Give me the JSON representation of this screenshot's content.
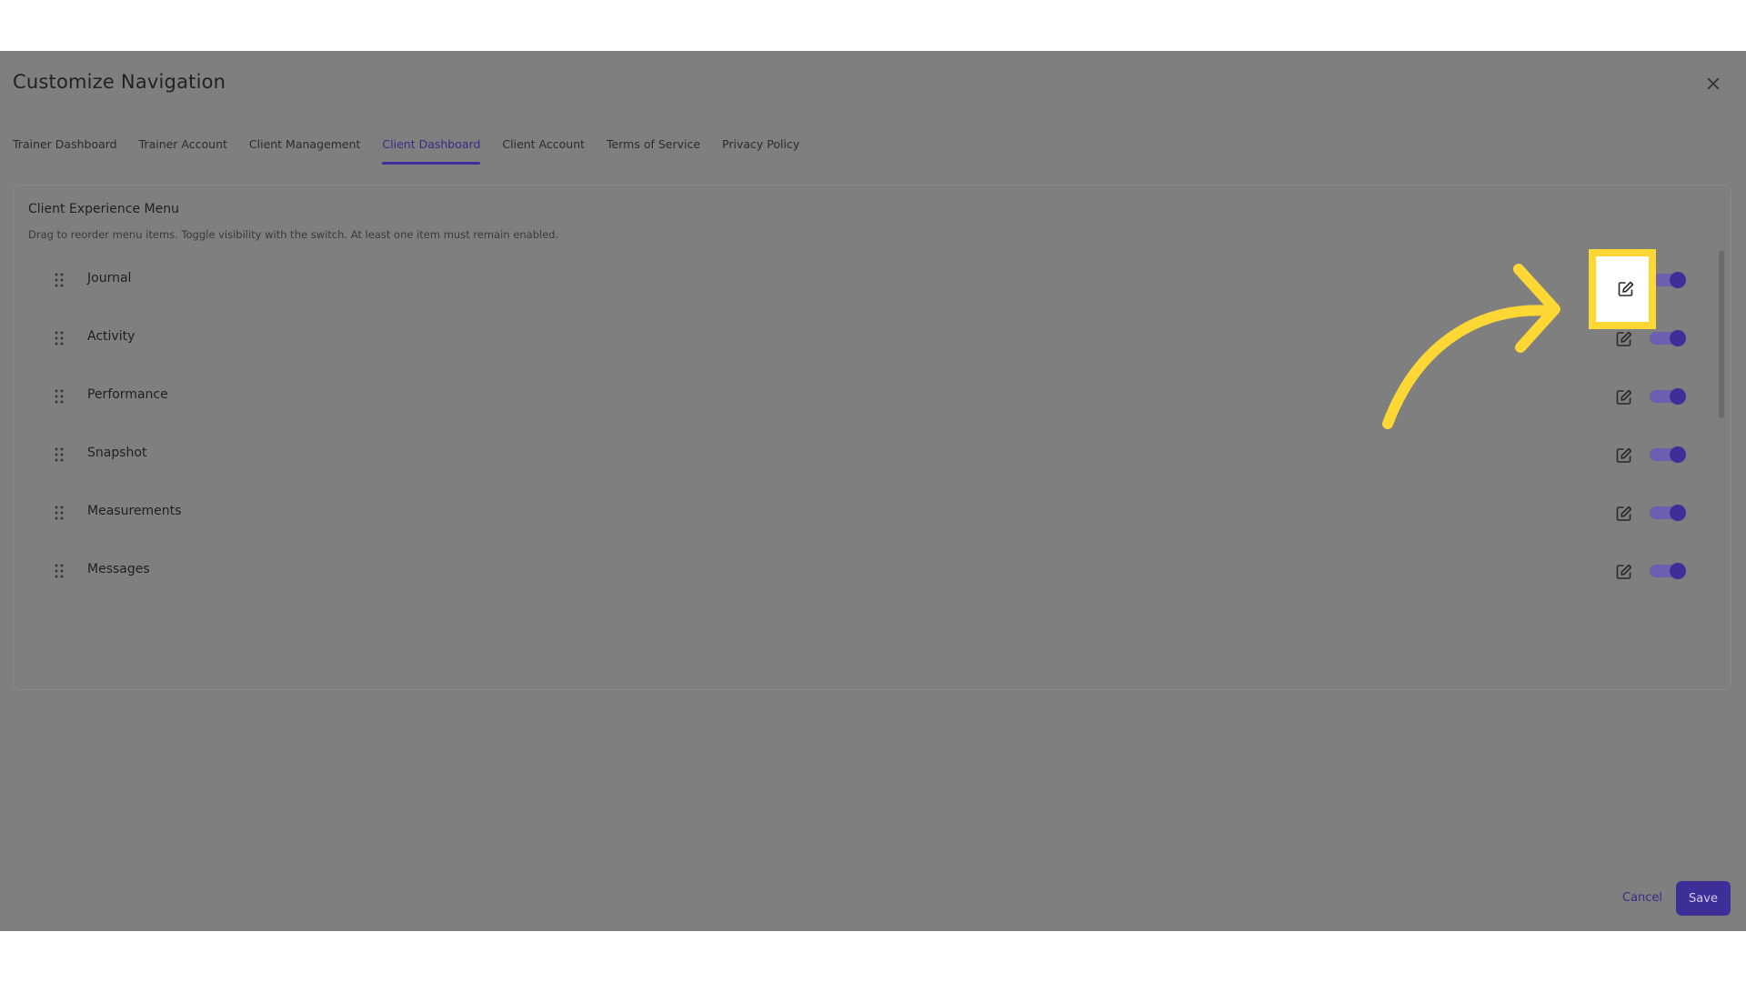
{
  "dialog": {
    "title": "Customize Navigation",
    "close_icon": "close-icon"
  },
  "tabs": [
    {
      "label": "Trainer Dashboard",
      "active": false
    },
    {
      "label": "Trainer Account",
      "active": false
    },
    {
      "label": "Client Management",
      "active": false
    },
    {
      "label": "Client Dashboard",
      "active": true
    },
    {
      "label": "Client Account",
      "active": false
    },
    {
      "label": "Terms of Service",
      "active": false
    },
    {
      "label": "Privacy Policy",
      "active": false
    }
  ],
  "panel": {
    "title": "Client Experience Menu",
    "description": "Drag to reorder menu items. Toggle visibility with the switch. At least one item must remain enabled.",
    "items": [
      {
        "label": "Journal",
        "enabled": true
      },
      {
        "label": "Activity",
        "enabled": true
      },
      {
        "label": "Performance",
        "enabled": true
      },
      {
        "label": "Snapshot",
        "enabled": true
      },
      {
        "label": "Measurements",
        "enabled": true
      },
      {
        "label": "Messages",
        "enabled": true
      }
    ]
  },
  "footer": {
    "cancel_label": "Cancel",
    "save_label": "Save"
  },
  "colors": {
    "accent": "#3c2f98",
    "overlay": "#7f7f7f",
    "highlight": "#fdd835"
  }
}
